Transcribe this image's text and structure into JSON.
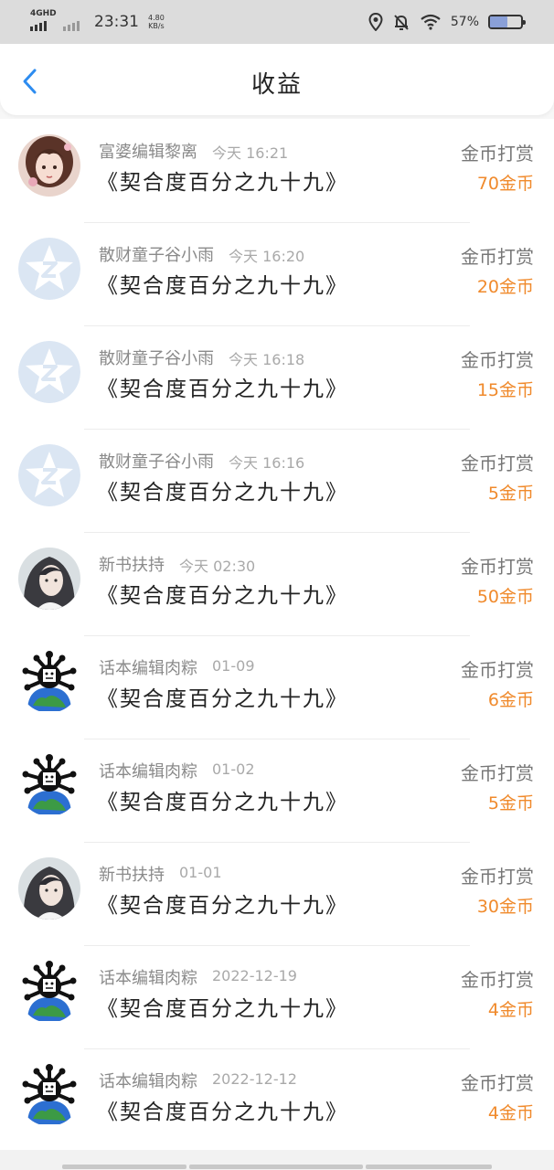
{
  "status_bar": {
    "network": "4GHD",
    "time": "23:31",
    "speed_value": "4.80",
    "speed_unit": "KB/s",
    "battery": "57%",
    "battery_level": 0.57,
    "icons": [
      "signal-icon",
      "location-icon",
      "mute-bell-icon",
      "wifi-icon",
      "battery-icon"
    ]
  },
  "header": {
    "title": "收益",
    "back_icon": "chevron-left-icon",
    "accent_color": "#2d8cf0"
  },
  "records": [
    {
      "sender": "富婆编辑黎离",
      "date": "今天 16:21",
      "book": "《契合度百分之九十九》",
      "type": "金币打赏",
      "amount": "70金币",
      "avatar": "avatar-girl"
    },
    {
      "sender": "散财童子谷小雨",
      "date": "今天 16:20",
      "book": "《契合度百分之九十九》",
      "type": "金币打赏",
      "amount": "20金币",
      "avatar": "avatar-default-logo"
    },
    {
      "sender": "散财童子谷小雨",
      "date": "今天 16:18",
      "book": "《契合度百分之九十九》",
      "type": "金币打赏",
      "amount": "15金币",
      "avatar": "avatar-default-logo"
    },
    {
      "sender": "散财童子谷小雨",
      "date": "今天 16:16",
      "book": "《契合度百分之九十九》",
      "type": "金币打赏",
      "amount": "5金币",
      "avatar": "avatar-default-logo"
    },
    {
      "sender": "新书扶持",
      "date": "今天 02:30",
      "book": "《契合度百分之九十九》",
      "type": "金币打赏",
      "amount": "50金币",
      "avatar": "avatar-ancient-man"
    },
    {
      "sender": "话本编辑肉粽",
      "date": "01-09",
      "book": "《契合度百分之九十九》",
      "type": "金币打赏",
      "amount": "6金币",
      "avatar": "avatar-earth-cartoon"
    },
    {
      "sender": "话本编辑肉粽",
      "date": "01-02",
      "book": "《契合度百分之九十九》",
      "type": "金币打赏",
      "amount": "5金币",
      "avatar": "avatar-earth-cartoon"
    },
    {
      "sender": "新书扶持",
      "date": "01-01",
      "book": "《契合度百分之九十九》",
      "type": "金币打赏",
      "amount": "30金币",
      "avatar": "avatar-ancient-man"
    },
    {
      "sender": "话本编辑肉粽",
      "date": "2022-12-19",
      "book": "《契合度百分之九十九》",
      "type": "金币打赏",
      "amount": "4金币",
      "avatar": "avatar-earth-cartoon"
    },
    {
      "sender": "话本编辑肉粽",
      "date": "2022-12-12",
      "book": "《契合度百分之九十九》",
      "type": "金币打赏",
      "amount": "4金币",
      "avatar": "avatar-earth-cartoon"
    }
  ],
  "colors": {
    "amount": "#f08a2c",
    "sender": "#8a8a8a",
    "date": "#a9a9a9",
    "book": "#222222"
  }
}
